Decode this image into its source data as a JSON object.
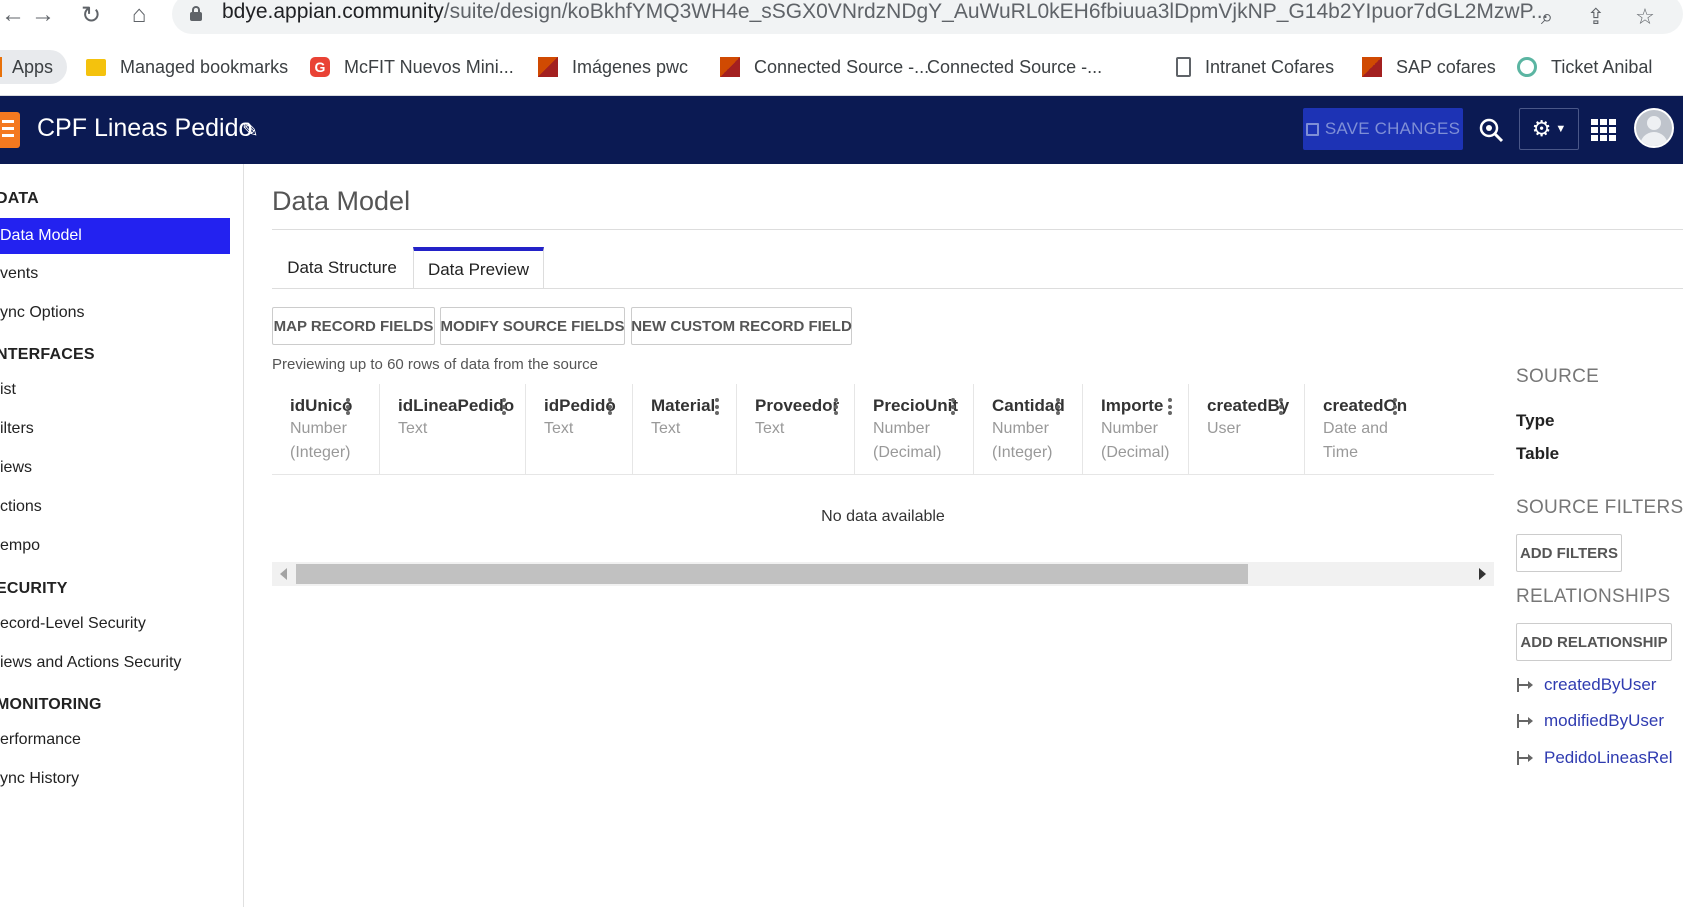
{
  "browser": {
    "url_domain": "bdye.appian.community",
    "url_path": "/suite/design/koBkhfYMQ3WH4e_sSGX0VNrdzNDgY_AuWuRL0kEH6fbiuua3lDpmVjkNP_G14b2YIpuor7dGL2MzwP...",
    "bookmarks": [
      {
        "label": "Apps",
        "icon": "apps-grid-icon",
        "color": "#e8710a"
      },
      {
        "label": "Managed bookmarks",
        "icon": "folder-icon",
        "color": "#f4c20d"
      },
      {
        "label": "McFIT Nuevos Mini...",
        "icon": "mcfit-g-icon",
        "color": "#e94235"
      },
      {
        "label": "Imágenes pwc",
        "icon": "pwc-icon",
        "color": "#d04a02"
      },
      {
        "label": "Connected Source -...",
        "icon": "pwc-icon",
        "color": "#d04a02"
      },
      {
        "label": "Connected Source -...",
        "icon": "blank-icon",
        "color": "#ffffff"
      },
      {
        "label": "Intranet Cofares",
        "icon": "page-icon",
        "color": "#5f6368"
      },
      {
        "label": "SAP cofares",
        "icon": "pwc-icon",
        "color": "#d04a02"
      },
      {
        "label": "Ticket Anibal",
        "icon": "circle-icon",
        "color": "#5bb5a2"
      }
    ]
  },
  "header": {
    "app_title": "CPF Lineas Pedido",
    "save_label": "SAVE CHANGES",
    "bg_color": "#0b1a53",
    "save_color": "#1d33b5"
  },
  "sidebar": {
    "sections": [
      {
        "label": "DATA",
        "items": [
          {
            "label": "Data Model",
            "active": true
          },
          {
            "label": "vents"
          },
          {
            "label": "ync Options"
          }
        ]
      },
      {
        "label": "NTERFACES",
        "items": [
          {
            "label": "ist"
          },
          {
            "label": "ilters"
          },
          {
            "label": "iews"
          },
          {
            "label": "ctions"
          },
          {
            "label": "empo"
          }
        ]
      },
      {
        "label": "ECURITY",
        "items": [
          {
            "label": "ecord-Level Security"
          },
          {
            "label": "iews and Actions Security"
          }
        ]
      },
      {
        "label": "MONITORING",
        "items": [
          {
            "label": "erformance"
          },
          {
            "label": "ync History"
          }
        ]
      }
    ],
    "active_color": "#2322f0"
  },
  "main": {
    "title": "Data Model",
    "tabs": [
      {
        "label": "Data Structure",
        "active": false
      },
      {
        "label": "Data Preview",
        "active": true
      }
    ],
    "toolbar": {
      "map_label": "MAP RECORD FIELDS",
      "modify_label": "MODIFY SOURCE FIELDS",
      "new_label": "NEW CUSTOM RECORD FIELD"
    },
    "preview_note": "Previewing up to 60 rows of data from the source",
    "columns": [
      {
        "name": "idUnico",
        "type1": "Number",
        "type2": "(Integer)"
      },
      {
        "name": "idLineaPedido",
        "type1": "Text",
        "type2": ""
      },
      {
        "name": "idPedido",
        "type1": "Text",
        "type2": ""
      },
      {
        "name": "Material",
        "type1": "Text",
        "type2": ""
      },
      {
        "name": "Proveedor",
        "type1": "Text",
        "type2": ""
      },
      {
        "name": "PrecioUnit",
        "type1": "Number",
        "type2": "(Decimal)"
      },
      {
        "name": "Cantidad",
        "type1": "Number",
        "type2": "(Integer)"
      },
      {
        "name": "Importe",
        "type1": "Number",
        "type2": "(Decimal)"
      },
      {
        "name": "createdBy",
        "type1": "User",
        "type2": ""
      },
      {
        "name": "createdOn",
        "type1": "Date and",
        "type2": "Time"
      }
    ],
    "empty_text": "No data available"
  },
  "right_panel": {
    "source_heading": "SOURCE",
    "type_label": "Type",
    "table_label": "Table",
    "filters_heading": "SOURCE FILTERS",
    "add_filters_label": "ADD FILTERS",
    "relationships_heading": "RELATIONSHIPS",
    "add_relationship_label": "ADD RELATIONSHIP",
    "relationships": [
      "createdByUser",
      "modifiedByUser",
      "PedidoLineasRel"
    ],
    "link_color": "#2f3bb0"
  }
}
